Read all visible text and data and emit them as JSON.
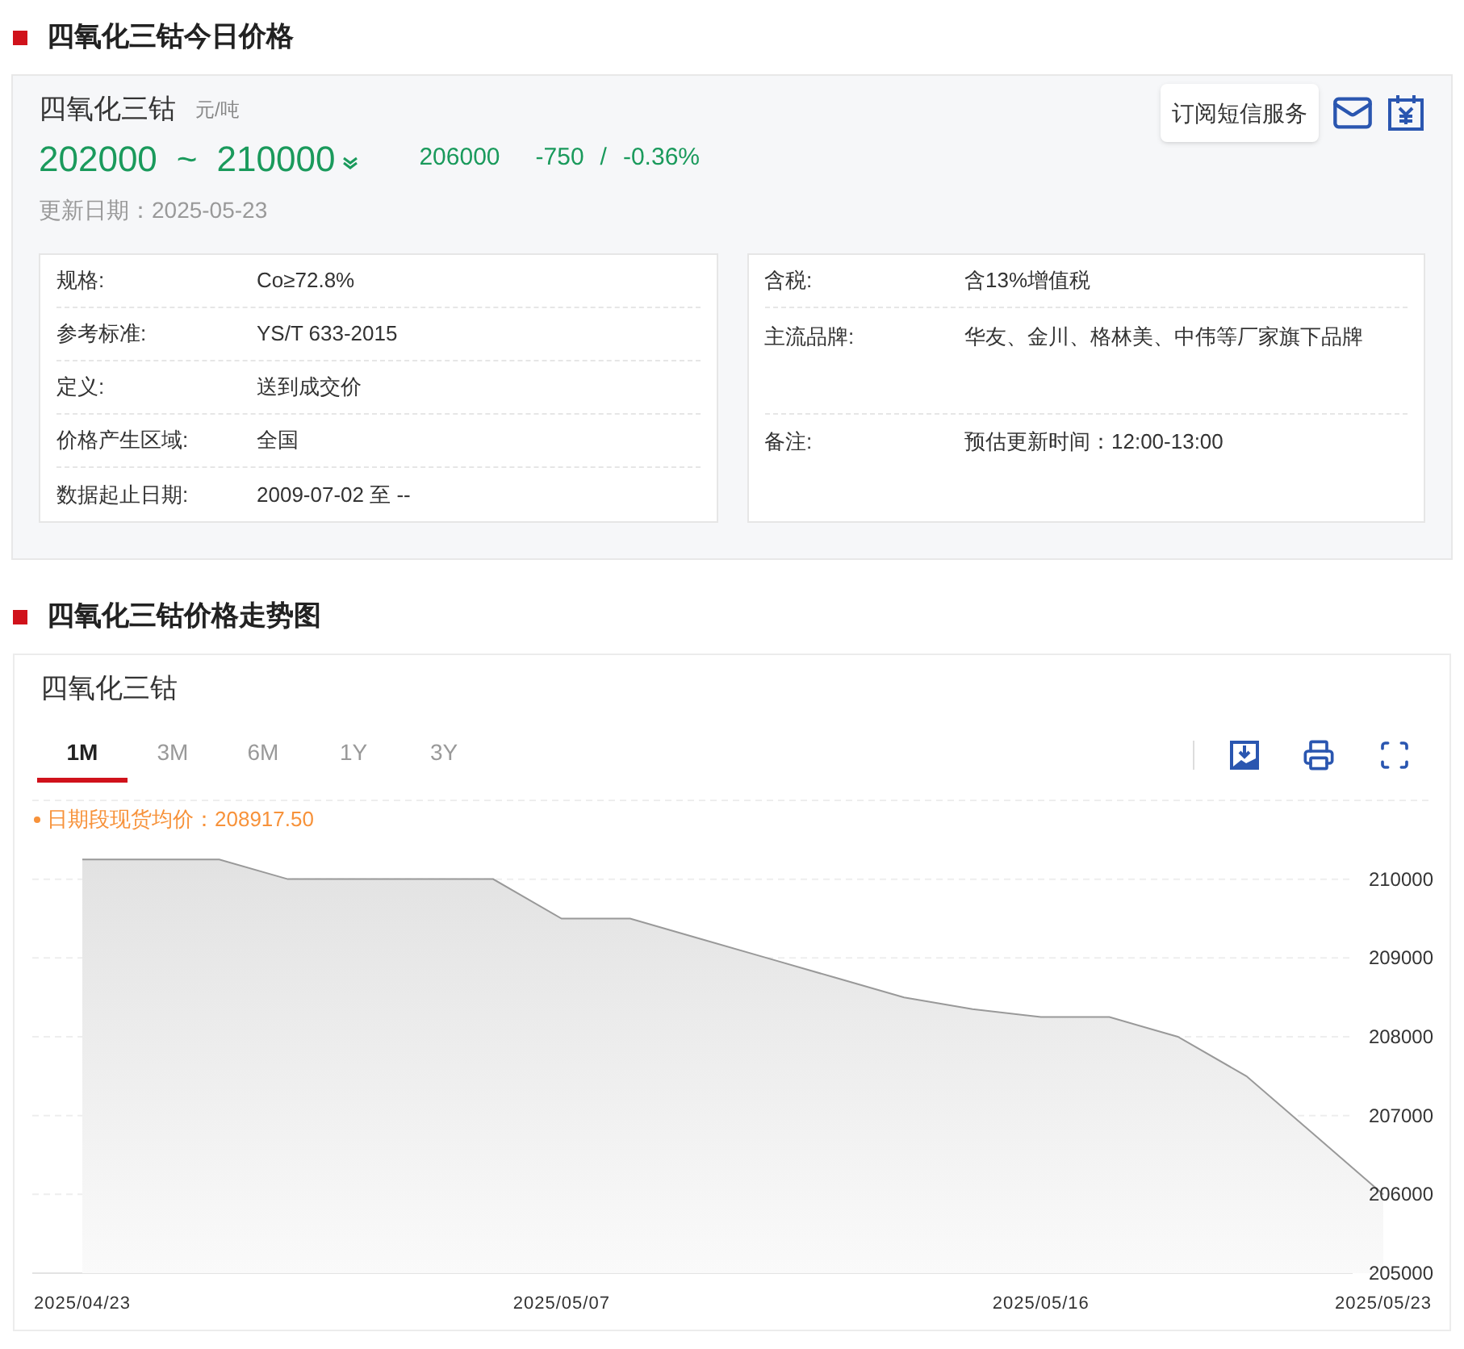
{
  "price_section": {
    "title": "四氧化三钴今日价格",
    "product": {
      "name": "四氧化三钴",
      "unit": "元/吨",
      "low": "202000",
      "separator": "~",
      "high": "210000",
      "falling": true,
      "average": "206000",
      "change": "-750",
      "slash": "/",
      "change_pct": "-0.36%",
      "updated": "更新日期：2025-05-23"
    },
    "subscribe_button": "订阅短信服务",
    "specs_left": [
      {
        "label": "规格:",
        "value": "Co≥72.8%"
      },
      {
        "label": "参考标准:",
        "value": "YS/T 633-2015"
      },
      {
        "label": "定义:",
        "value": "送到成交价"
      },
      {
        "label": "价格产生区域:",
        "value": "全国"
      },
      {
        "label": "数据起止日期:",
        "value": "2009-07-02 至 --"
      }
    ],
    "specs_right": [
      {
        "label": "含税:",
        "value": "含13%增值税",
        "kind": "single"
      },
      {
        "label": "主流品牌:",
        "value": "华友、金川、格林美、中伟等厂家旗下品牌",
        "kind": "tall"
      },
      {
        "label": "备注:",
        "value": "预估更新时间：12:00-13:00",
        "kind": "single"
      }
    ]
  },
  "trend_section": {
    "title": "四氧化三钴价格走势图",
    "chart_title": "四氧化三钴",
    "range_tabs": [
      {
        "label": "1M",
        "selected": true
      },
      {
        "label": "3M",
        "selected": false
      },
      {
        "label": "6M",
        "selected": false
      },
      {
        "label": "1Y",
        "selected": false
      },
      {
        "label": "3Y",
        "selected": false
      }
    ],
    "legend_value": "：208917.50",
    "chart_data": {
      "type": "area",
      "grid": true,
      "categories": [
        "2025/04/23",
        null,
        null,
        null,
        null,
        null,
        null,
        "2025/05/07",
        null,
        null,
        null,
        null,
        null,
        null,
        "2025/05/16",
        null,
        null,
        null,
        null,
        "2025/05/23"
      ],
      "series": [
        {
          "name": "日期段现货均价",
          "color": "#999999",
          "values": [
            210250,
            210250,
            210250,
            210000,
            210000,
            210000,
            210000,
            209500,
            209500,
            209250,
            209000,
            208750,
            208500,
            208350,
            208250,
            208250,
            208000,
            207500,
            206750,
            206000
          ]
        }
      ],
      "ylim": [
        205000,
        211000
      ],
      "yticks": [
        205000,
        206000,
        207000,
        208000,
        209000,
        210000
      ]
    }
  }
}
